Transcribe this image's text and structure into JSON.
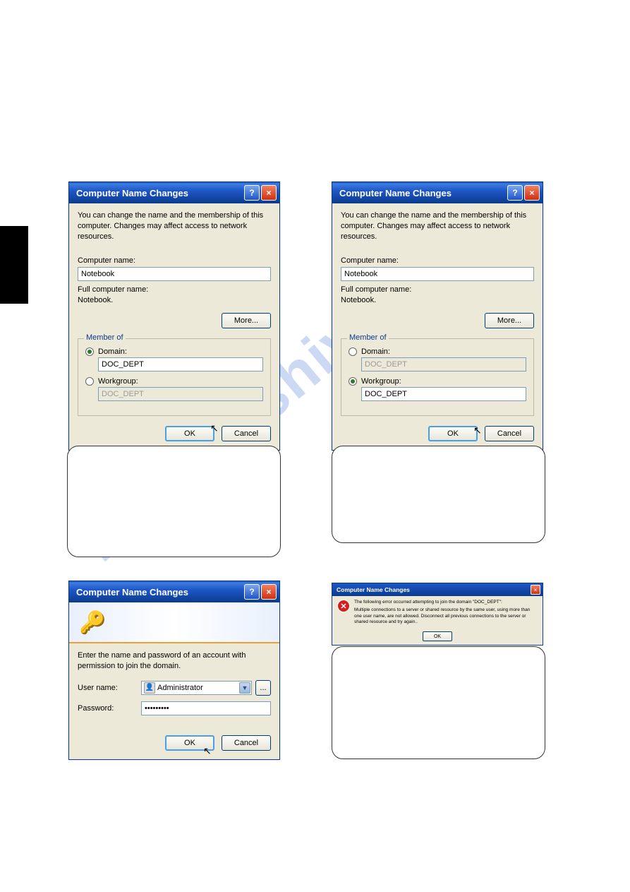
{
  "watermark": "manualshive.com",
  "dlg_domain": {
    "title": "Computer Name Changes",
    "intro": "You can change the name and the membership of this computer. Changes may affect access to network resources.",
    "comp_name_lbl": "Computer name:",
    "comp_name_val": "Notebook",
    "full_lbl": "Full computer name:",
    "full_val": "Notebook.",
    "member_legend": "Member of",
    "domain_lbl": "Domain:",
    "domain_val": "DOC_DEPT",
    "workgroup_lbl": "Workgroup:",
    "workgroup_val": "DOC_DEPT",
    "more_btn": "More...",
    "ok_btn": "OK",
    "cancel_btn": "Cancel"
  },
  "dlg_workgroup": {
    "title": "Computer Name Changes",
    "intro": "You can change the name and the membership of this computer. Changes may affect access to network resources.",
    "comp_name_lbl": "Computer name:",
    "comp_name_val": "Notebook",
    "full_lbl": "Full computer name:",
    "full_val": "Notebook.",
    "member_legend": "Member of",
    "domain_lbl": "Domain:",
    "domain_val": "DOC_DEPT",
    "workgroup_lbl": "Workgroup:",
    "workgroup_val": "DOC_DEPT",
    "more_btn": "More...",
    "ok_btn": "OK",
    "cancel_btn": "Cancel"
  },
  "dlg_creds": {
    "title": "Computer Name Changes",
    "intro": "Enter the name and password of an account with permission to join the domain.",
    "user_lbl": "User name:",
    "user_val": "Administrator",
    "pw_lbl": "Password:",
    "pw_val": "•••••••••",
    "ok_btn": "OK",
    "cancel_btn": "Cancel"
  },
  "dlg_error": {
    "title": "Computer Name Changes",
    "line1": "The following error occurred attempting to join the domain \"DOC_DEPT\":",
    "line2": "Multiple connections to a server or shared resource by the same user, using more than one user name, are not allowed. Disconnect all previous connections to the server or shared resource and try again..",
    "ok_btn": "OK"
  }
}
